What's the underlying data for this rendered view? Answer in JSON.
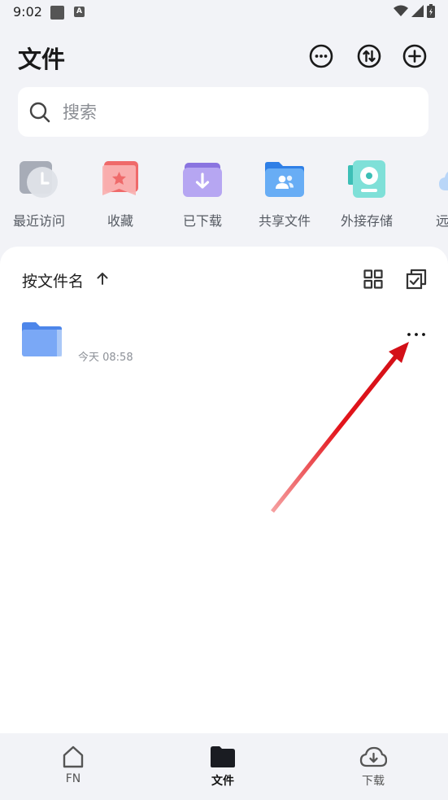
{
  "status_bar": {
    "time": "9:02"
  },
  "header": {
    "title": "文件"
  },
  "search": {
    "placeholder": "搜索"
  },
  "quick_access": [
    {
      "label": "最近访问",
      "icon": "clock-icon"
    },
    {
      "label": "收藏",
      "icon": "star-bookmark-icon"
    },
    {
      "label": "已下载",
      "icon": "download-folder-icon"
    },
    {
      "label": "共享文件",
      "icon": "shared-folder-icon"
    },
    {
      "label": "外接存储",
      "icon": "external-storage-icon"
    },
    {
      "label": "远程",
      "icon": "cloud-icon"
    }
  ],
  "file_list": {
    "sort_label": "按文件名",
    "items": [
      {
        "name": "",
        "date": "今天 08:58",
        "more_label": "···"
      }
    ]
  },
  "bottom_nav": [
    {
      "label": "FN",
      "icon": "home-icon",
      "active": false
    },
    {
      "label": "文件",
      "icon": "folder-icon",
      "active": true
    },
    {
      "label": "下载",
      "icon": "cloud-download-icon",
      "active": false
    }
  ],
  "colors": {
    "background": "#f2f3f7",
    "accent_folder": "#6e9ef5",
    "annotation_arrow": "#e3141b"
  }
}
